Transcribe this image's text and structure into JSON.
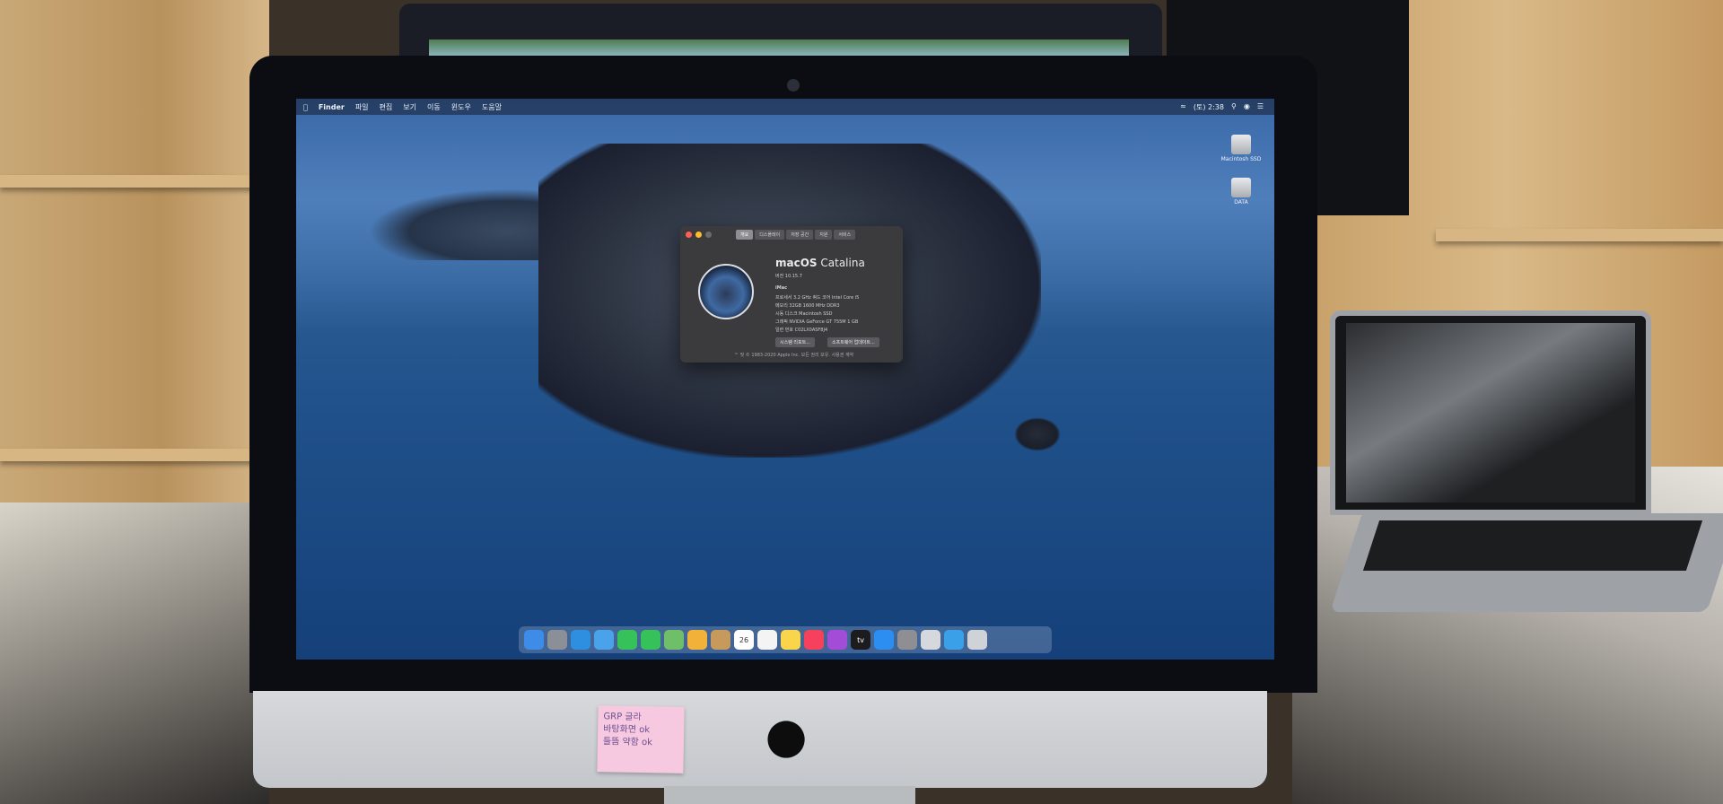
{
  "menubar": {
    "apple": "",
    "items": [
      "Finder",
      "파일",
      "편집",
      "보기",
      "이동",
      "윈도우",
      "도움말"
    ],
    "clock": "(토) 2:38"
  },
  "desktop": {
    "icons": [
      {
        "label": "Macintosh SSD",
        "icon": "hard-disk-icon"
      },
      {
        "label": "DATA",
        "icon": "hard-disk-icon"
      }
    ]
  },
  "about_window": {
    "tabs": [
      "개요",
      "디스플레이",
      "저장 공간",
      "지원",
      "서비스"
    ],
    "active_tab": 0,
    "os_name": "macOS",
    "os_version_name": "Catalina",
    "version": "버전 10.15.7",
    "model": "iMac",
    "lines": [
      "프로세서   3.2 GHz 쿼드 코어 Intel Core i5",
      "메모리   32GB 1600 MHz DDR3",
      "시동 디스크   Macintosh SSD",
      "그래픽   NVIDIA GeForce GT 755M 1 GB",
      "일련 번호   C02LX0ASF8J4"
    ],
    "buttons": [
      "시스템 리포트...",
      "소프트웨어 업데이트..."
    ],
    "footer": "™ 및 © 1983-2020 Apple Inc. 모든 권리 보유. 사용권 계약"
  },
  "dock": {
    "items": [
      {
        "name": "finder",
        "color": "#3d8ce8"
      },
      {
        "name": "launchpad",
        "color": "#8a8f98"
      },
      {
        "name": "safari",
        "color": "#2e8ee0"
      },
      {
        "name": "mail",
        "color": "#4aa3ea"
      },
      {
        "name": "facetime",
        "color": "#36c25a"
      },
      {
        "name": "messages",
        "color": "#36c25a"
      },
      {
        "name": "maps",
        "color": "#6fbf6a"
      },
      {
        "name": "photos",
        "color": "#f2b23a"
      },
      {
        "name": "contacts",
        "color": "#c69a5c"
      },
      {
        "name": "calendar",
        "color": "#ffffff",
        "text": "26"
      },
      {
        "name": "reminders",
        "color": "#f4f4f4"
      },
      {
        "name": "notes",
        "color": "#f8d54b"
      },
      {
        "name": "music",
        "color": "#f6415c"
      },
      {
        "name": "podcasts",
        "color": "#a24cd8"
      },
      {
        "name": "tv",
        "color": "#1c1c1e",
        "text": "tv"
      },
      {
        "name": "app-store",
        "color": "#2b8ef0"
      },
      {
        "name": "system-preferences",
        "color": "#8e8e93"
      },
      {
        "name": "preview",
        "color": "#d5d9de"
      },
      {
        "name": "downloads",
        "color": "#3aa0e8"
      },
      {
        "name": "trash",
        "color": "#cfd3d8"
      }
    ]
  },
  "sticky_note": {
    "lines": [
      "GRP 글라",
      "바탕화면 ok",
      "들뜸 약함 ok"
    ]
  },
  "colors": {
    "desktop_sky": "#4f7fbb",
    "desktop_sea": "#1f4f88",
    "window": "#3b3b3e",
    "sticky": "#f7c9e0"
  }
}
